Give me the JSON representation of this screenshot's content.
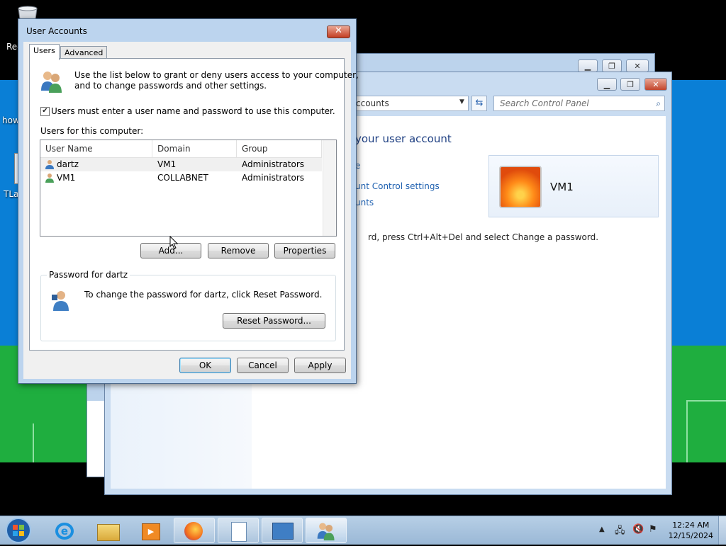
{
  "desktop": {
    "labels": [
      "Rec",
      "how",
      "TLa"
    ]
  },
  "control_panel": {
    "address_text": "ccounts",
    "search_placeholder": "Search Control Panel",
    "heading": "your user account",
    "links": [
      "e",
      "unt Control settings",
      "unts"
    ],
    "note": "rd, press Ctrl+Alt+Del and select Change a password.",
    "user_name": "VM1",
    "help_glyph": "?"
  },
  "dialog": {
    "title": "User Accounts",
    "close_glyph": "✕",
    "tabs": [
      "Users",
      "Advanced"
    ],
    "intro_line1": "Use the list below to grant or deny users access to your computer,",
    "intro_line2": "and to change passwords and other settings.",
    "checkbox_label": "Users must enter a user name and password to use this computer.",
    "checkbox_checked": true,
    "users_label": "Users for this computer:",
    "columns": [
      "User Name",
      "Domain",
      "Group"
    ],
    "rows": [
      {
        "user": "dartz",
        "domain": "VM1",
        "group": "Administrators"
      },
      {
        "user": "VM1",
        "domain": "COLLABNET",
        "group": "Administrators"
      }
    ],
    "buttons": {
      "add": "Add...",
      "remove": "Remove",
      "properties": "Properties"
    },
    "password_group_label": "Password for dartz",
    "password_text": "To change the password for dartz, click Reset Password.",
    "reset_button": "Reset Password...",
    "footer": {
      "ok": "OK",
      "cancel": "Cancel",
      "apply": "Apply"
    }
  },
  "taskbar": {
    "clock_time": "12:24 AM",
    "clock_date": "12/15/2024",
    "apps": [
      "start-orb",
      "internet-explorer",
      "file-explorer",
      "media-player",
      "firefox",
      "document",
      "control-panel",
      "user-accounts"
    ]
  },
  "colors": {
    "wallpaper_blue": "#0a7fd6",
    "wallpaper_green": "#1fae3f",
    "link_blue": "#1e60b0",
    "heading_blue": "#1e3f82"
  }
}
